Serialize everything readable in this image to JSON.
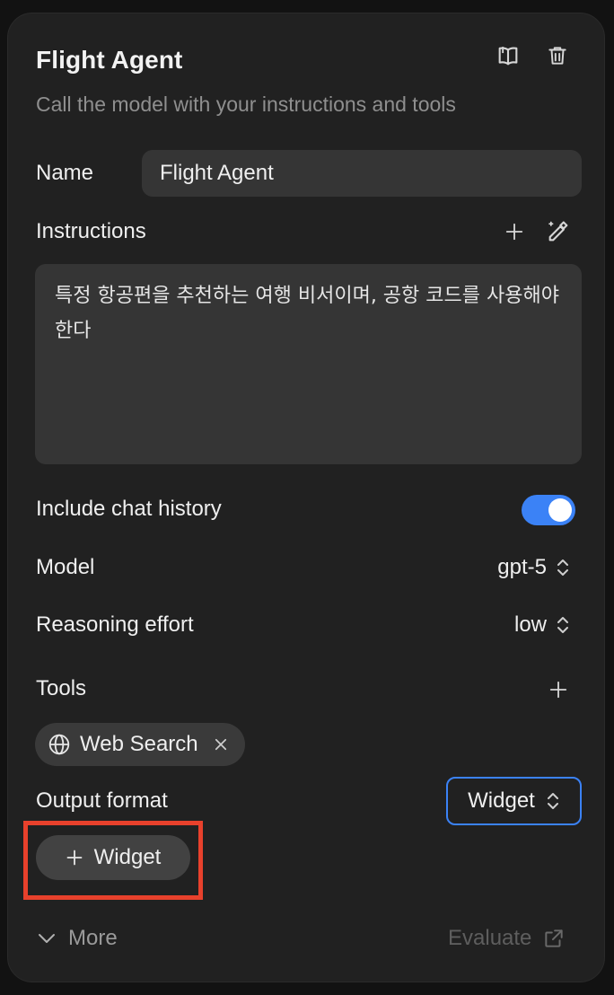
{
  "header": {
    "title": "Flight Agent",
    "subtitle": "Call the model with your instructions and tools",
    "icons": [
      "book-icon",
      "trash-icon"
    ]
  },
  "name": {
    "label": "Name",
    "value": "Flight Agent"
  },
  "instructions": {
    "label": "Instructions",
    "text": "특정 항공편을 추천하는 여행 비서이며, 공항 코드를 사용해야 한다",
    "icons": [
      "plus-icon",
      "magic-wand-icon"
    ]
  },
  "chat_history": {
    "label": "Include chat history",
    "enabled": true
  },
  "model": {
    "label": "Model",
    "value": "gpt-5"
  },
  "reasoning": {
    "label": "Reasoning effort",
    "value": "low"
  },
  "tools": {
    "label": "Tools",
    "items": [
      {
        "label": "Web Search",
        "icon": "globe-icon"
      }
    ]
  },
  "output_format": {
    "label": "Output format",
    "value": "Widget",
    "add_button_label": "Widget"
  },
  "footer": {
    "more_label": "More",
    "evaluate_label": "Evaluate"
  },
  "colors": {
    "accent": "#3b82f6",
    "highlight": "#e8412c",
    "panel": "#212121",
    "field": "#353535"
  }
}
